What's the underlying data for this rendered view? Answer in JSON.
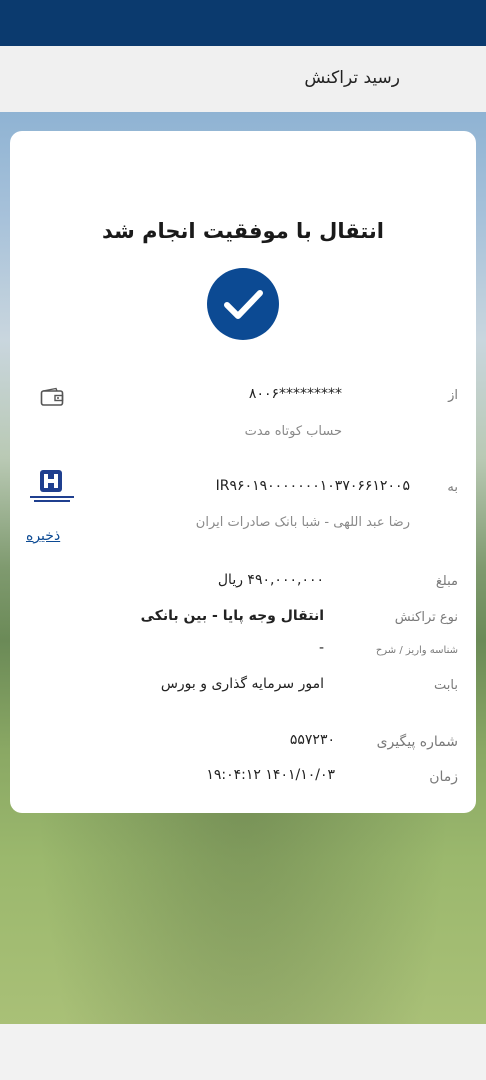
{
  "header": {
    "title": "رسید تراکنش"
  },
  "receipt": {
    "success_message": "انتقال با موفقیت انجام شد",
    "from": {
      "label": "از",
      "account": "*********۸۰۰۶",
      "account_type": "حساب کوتاه مدت",
      "icon": "wallet-icon"
    },
    "to": {
      "label": "به",
      "iban": "IR۹۶۰۱۹۰۰۰۰۰۰۰۱۰۳۷۰۶۶۱۲۰۰۵",
      "owner_bank": "رضا عبد اللهی - شبا بانک صادرات ایران",
      "bank_logo": "bank-saderat-logo",
      "save_label": "ذخیره"
    },
    "amount": {
      "label": "مبلغ",
      "value": "۴۹۰,۰۰۰,۰۰۰ ریال"
    },
    "transaction_type": {
      "label": "نوع تراکنش",
      "value": "انتقال وجه پایا - بین بانکی"
    },
    "deposit_id": {
      "label": "شناسه واریز / شرح",
      "value": "-"
    },
    "purpose": {
      "label": "بابت",
      "value": "امور سرمایه گذاری و بورس"
    },
    "tracking": {
      "label": "شماره پیگیری",
      "value": "۵۵۷۲۳۰"
    },
    "time": {
      "label": "زمان",
      "value": "۱۴۰۱/۱۰/۰۳   ۱۹:۰۴:۱۲"
    }
  },
  "colors": {
    "brand": "#0c4a93",
    "status_bar": "#0b3a6e"
  }
}
